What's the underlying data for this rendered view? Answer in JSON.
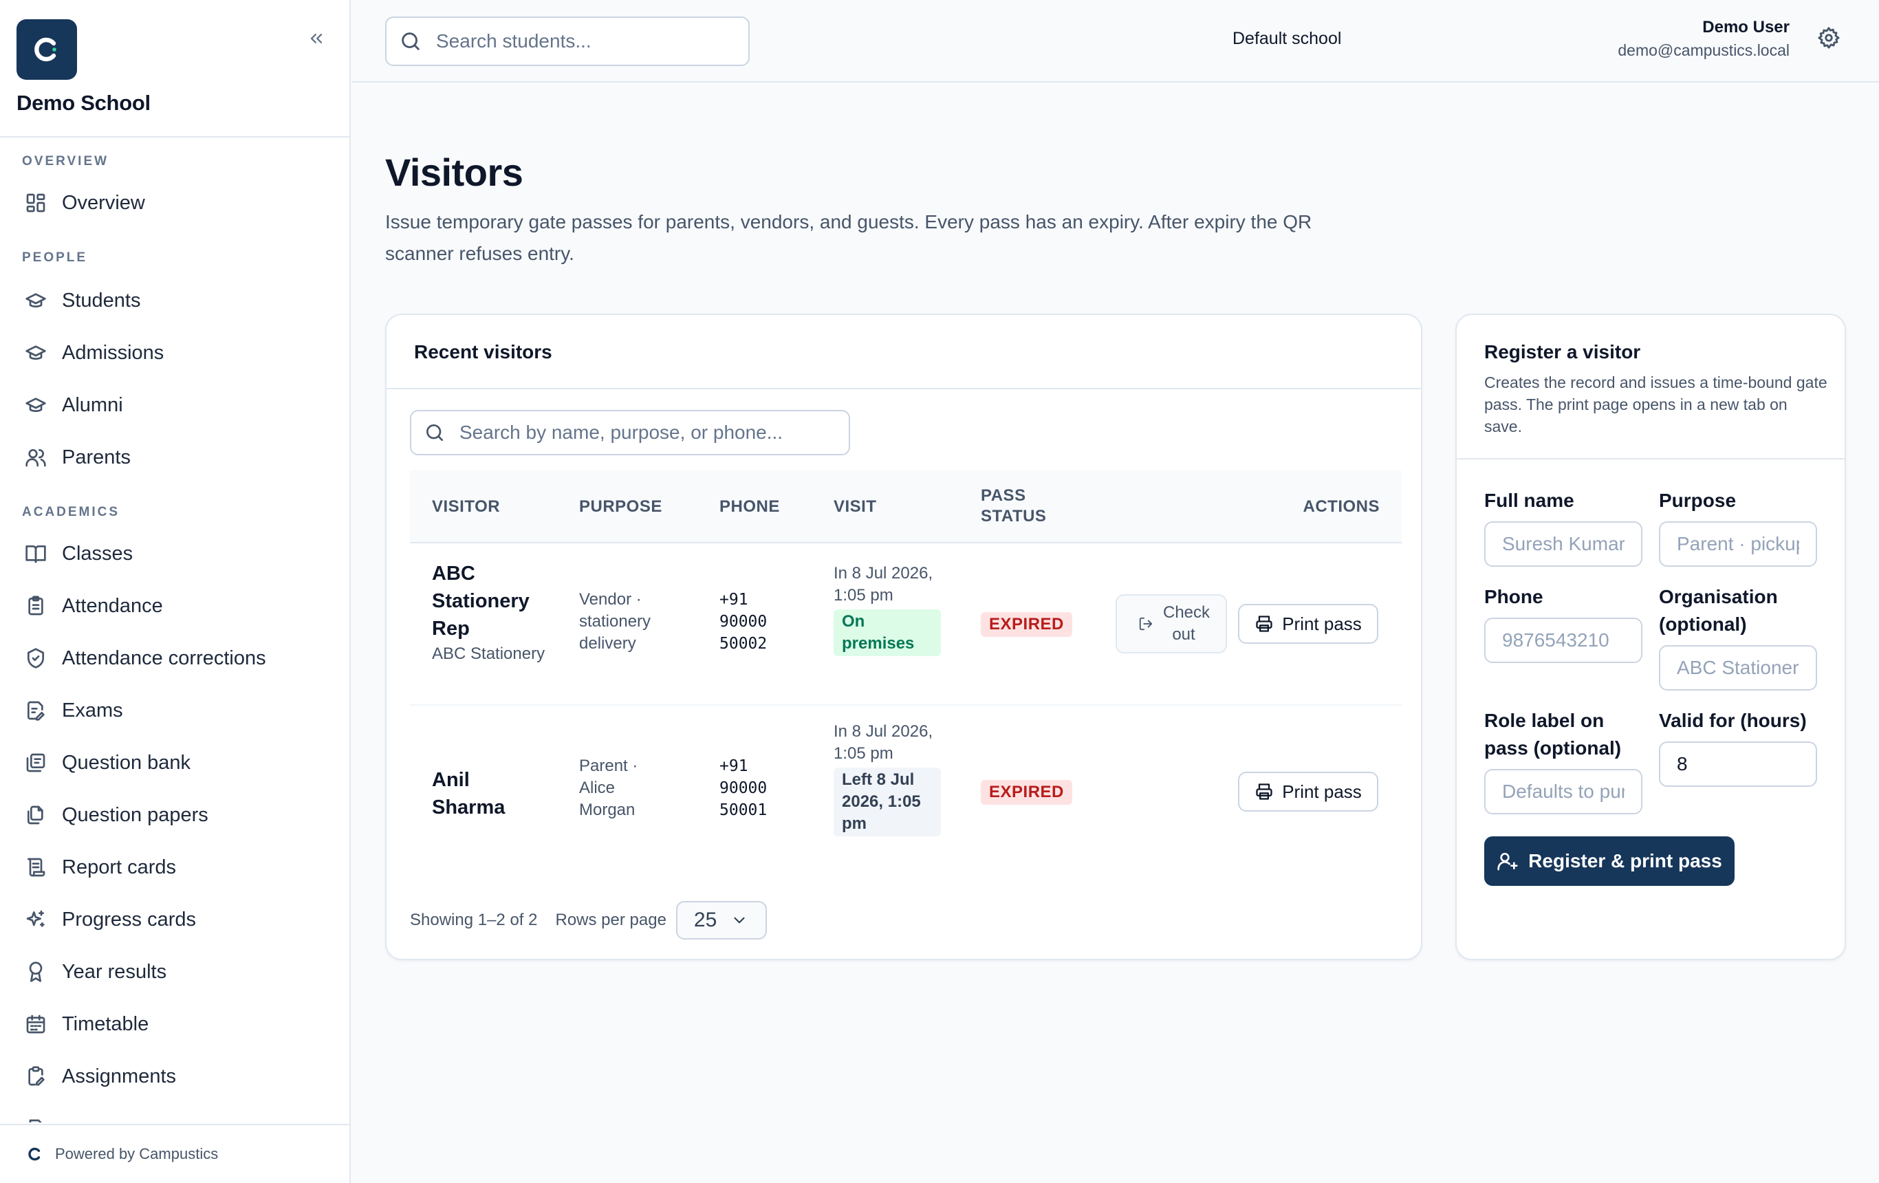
{
  "sidebar": {
    "school_name": "Demo School",
    "sections": {
      "overview": "OVERVIEW",
      "people": "PEOPLE",
      "academics": "ACADEMICS"
    },
    "items": {
      "overview": "Overview",
      "students": "Students",
      "admissions": "Admissions",
      "alumni": "Alumni",
      "parents": "Parents",
      "classes": "Classes",
      "attendance": "Attendance",
      "attendance_corrections": "Attendance corrections",
      "exams": "Exams",
      "question_bank": "Question bank",
      "question_papers": "Question papers",
      "report_cards": "Report cards",
      "progress_cards": "Progress cards",
      "year_results": "Year results",
      "timetable": "Timetable",
      "assignments": "Assignments"
    },
    "footer": "Powered by Campustics"
  },
  "topbar": {
    "search_placeholder": "Search students...",
    "school": "Default school",
    "user_name": "Demo User",
    "user_email": "demo@campustics.local"
  },
  "page": {
    "title": "Visitors",
    "description": "Issue temporary gate passes for parents, vendors, and guests. Every pass has an expiry. After expiry the QR scanner refuses entry."
  },
  "recent": {
    "title": "Recent visitors",
    "search_placeholder": "Search by name, purpose, or phone...",
    "columns": {
      "visitor": "VISITOR",
      "purpose": "PURPOSE",
      "phone": "PHONE",
      "visit": "VISIT",
      "pass_status_1": "PASS",
      "pass_status_2": "STATUS",
      "actions": "ACTIONS"
    },
    "rows": [
      {
        "name": "ABC Stationery Rep",
        "org": "ABC Stationery",
        "purpose": "Vendor · stationery delivery",
        "phone": "+91 90000 50002",
        "visit_in": "In 8 Jul 2026, 1:05 pm",
        "visit_badge": "On premises",
        "status": "EXPIRED",
        "checkout_label": "Check out",
        "print_label": "Print pass"
      },
      {
        "name": "Anil Sharma",
        "org": "",
        "purpose": "Parent · Alice Morgan",
        "phone": "+91 90000 50001",
        "visit_in": "In 8 Jul 2026, 1:05 pm",
        "visit_badge": "Left 8 Jul 2026, 1:05 pm",
        "status": "EXPIRED",
        "print_label": "Print pass"
      }
    ],
    "pager": {
      "showing": "Showing 1–2 of 2",
      "rows_label": "Rows per page",
      "rows_value": "25"
    }
  },
  "register": {
    "title": "Register a visitor",
    "description": "Creates the record and issues a time-bound gate pass. The print page opens in a new tab on save.",
    "full_name_label": "Full name",
    "full_name_placeholder": "Suresh Kumar",
    "purpose_label": "Purpose",
    "purpose_placeholder": "Parent · pickup",
    "phone_label": "Phone",
    "phone_placeholder": "9876543210",
    "org_label": "Organisation (optional)",
    "org_placeholder": "ABC Stationery",
    "role_label": "Role label on pass (optional)",
    "role_placeholder": "Defaults to purpose",
    "valid_label": "Valid for (hours)",
    "valid_value": "8",
    "submit_label": "Register & print pass"
  },
  "colors": {
    "brand": "#16365a",
    "expired": "#b91c1c",
    "on_premises": "#047857"
  }
}
